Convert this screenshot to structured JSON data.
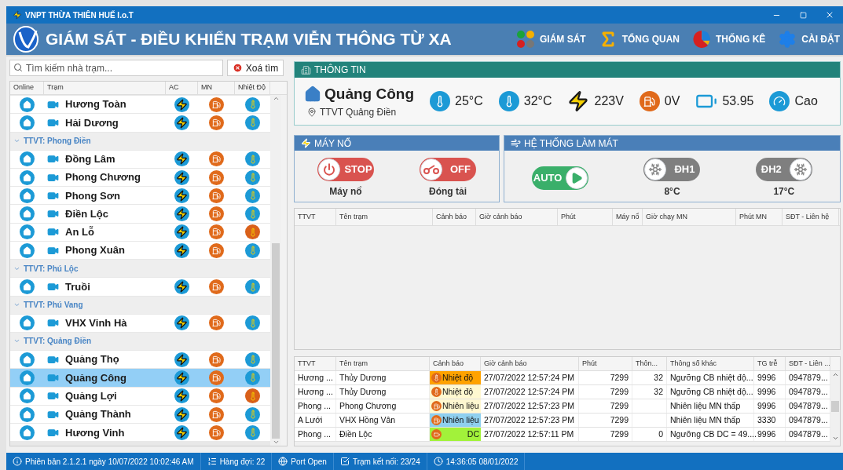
{
  "window": {
    "title": "VNPT THỪA THIÊN HUẾ I.o.T"
  },
  "header": {
    "title": "GIÁM SÁT - ĐIỀU KHIỂN TRẠM VIỄN THÔNG TỪ XA",
    "nav": [
      {
        "label": "GIÁM SÁT",
        "kind": "monitor"
      },
      {
        "label": "TỔNG QUAN",
        "kind": "overview"
      },
      {
        "label": "THỐNG KÊ",
        "kind": "stats"
      },
      {
        "label": "CÀI ĐẶT",
        "kind": "settings"
      }
    ]
  },
  "search": {
    "placeholder": "Tìm kiếm nhà trạm...",
    "clear_button": "Xoá tìm"
  },
  "station_table": {
    "columns": [
      "Online",
      "Trạm",
      "AC",
      "MN",
      "Nhiệt Độ"
    ],
    "groups": [
      {
        "stations": [
          {
            "name": "Hương Toàn",
            "selected": false,
            "temp_alert": false
          },
          {
            "name": "Hải Dương",
            "selected": false,
            "temp_alert": false
          }
        ]
      },
      {
        "label": "TTVT: Phong Điền",
        "expanded": true,
        "stations": [
          {
            "name": "Đồng Lâm",
            "selected": false,
            "temp_alert": false
          },
          {
            "name": "Phong Chương",
            "selected": false,
            "temp_alert": false
          },
          {
            "name": "Phong Sơn",
            "selected": false,
            "temp_alert": false
          },
          {
            "name": "Điền Lộc",
            "selected": false,
            "temp_alert": false
          },
          {
            "name": "An Lỗ",
            "selected": false,
            "temp_alert": true
          },
          {
            "name": "Phong Xuân",
            "selected": false,
            "temp_alert": false
          }
        ]
      },
      {
        "label": "TTVT: Phú Lộc",
        "expanded": true,
        "stations": [
          {
            "name": "Truồi",
            "selected": false,
            "temp_alert": false
          }
        ]
      },
      {
        "label": "TTVT: Phú Vang",
        "expanded": true,
        "stations": [
          {
            "name": "VHX Vinh Hà",
            "selected": false,
            "temp_alert": false
          }
        ]
      },
      {
        "label": "TTVT: Quảng Điền",
        "expanded": true,
        "stations": [
          {
            "name": "Quảng Thọ",
            "selected": false,
            "temp_alert": false
          },
          {
            "name": "Quảng Công",
            "selected": true,
            "temp_alert": false
          },
          {
            "name": "Quảng Lợi",
            "selected": false,
            "temp_alert": true
          },
          {
            "name": "Quảng Thành",
            "selected": false,
            "temp_alert": false
          },
          {
            "name": "Hương Vinh",
            "selected": false,
            "temp_alert": false
          }
        ]
      }
    ]
  },
  "info": {
    "title": "THÔNG TIN",
    "station": "Quảng Công",
    "location": "TTVT Quảng Điền",
    "readings": [
      {
        "kind": "temp",
        "value": "25°C"
      },
      {
        "kind": "temp",
        "value": "32°C"
      },
      {
        "kind": "ac",
        "value": "223V"
      },
      {
        "kind": "generator",
        "value": "0V"
      },
      {
        "kind": "battery",
        "value": "53.95"
      },
      {
        "kind": "gauge",
        "value": "Cao"
      }
    ]
  },
  "generator": {
    "title": "MÁY NỔ",
    "toggles": [
      {
        "kind": "power",
        "text": "STOP",
        "label": "Máy nổ",
        "color": "#d9534f",
        "knob_right": false
      },
      {
        "kind": "load",
        "text": "OFF",
        "label": "Đóng tải",
        "color": "#d9534f",
        "knob_right": false
      }
    ]
  },
  "cooling": {
    "title": "HỆ THỐNG LÀM MÁT",
    "toggles": [
      {
        "kind": "auto",
        "text": "AUTO",
        "color": "#3aaf6a",
        "knob_right": true
      },
      {
        "kind": "fan",
        "text": "ĐH1",
        "label": "8°C",
        "color": "#7f7f7f",
        "knob_right": false
      },
      {
        "kind": "fan",
        "text": "ĐH2",
        "label": "17°C",
        "color": "#7f7f7f",
        "knob_right": true
      }
    ]
  },
  "log_table": {
    "columns": [
      "TTVT",
      "Tên trạm",
      "Cảnh báo",
      "Giờ cảnh báo",
      "Phút",
      "Máy nổ",
      "Giờ chạy MN",
      "Phút MN",
      "SĐT - Liên hệ"
    ]
  },
  "alert_table": {
    "columns": [
      "TTVT",
      "Tên trạm",
      "Cảnh báo",
      "Giờ cảnh báo",
      "Phút",
      "Thôn...",
      "Thông số khác",
      "TG trễ",
      "SĐT - Liên ..."
    ],
    "rows": [
      {
        "ttvt": "Hương ...",
        "station": "Thủy Dương",
        "alert": {
          "kind": "temp",
          "text": "Nhiệt độ",
          "color": "#ffa200"
        },
        "time": "27/07/2022 12:57:24 PM",
        "minutes": "7299",
        "column_6": "32",
        "other": "Ngưỡng CB nhiệt độ...",
        "delay": "9996",
        "phone": "0947879..."
      },
      {
        "ttvt": "Hương ...",
        "station": "Thủy Dương",
        "alert": {
          "kind": "temp",
          "text": "Nhiệt độ",
          "color": "#fff8d0"
        },
        "time": "27/07/2022 12:57:24 PM",
        "minutes": "7299",
        "column_6": "32",
        "other": "Ngưỡng CB nhiệt độ...",
        "delay": "9996",
        "phone": "0947879..."
      },
      {
        "ttvt": "Phong ...",
        "station": "Phong Chương",
        "alert": {
          "kind": "fuel",
          "text": "Nhiên liệu",
          "color": "#fff8d0"
        },
        "time": "27/07/2022 12:57:23 PM",
        "minutes": "7299",
        "other": "Nhiên liệu MN thấp",
        "delay": "9996",
        "phone": "0947879..."
      },
      {
        "ttvt": "A Lưới",
        "station": "VHX Hồng Vân",
        "alert": {
          "kind": "fuel",
          "text": "Nhiên liệu",
          "color": "#8fd0ef"
        },
        "time": "27/07/2022 12:57:23 PM",
        "minutes": "7299",
        "other": "Nhiên liệu MN thấp",
        "delay": "3330",
        "phone": "0947879..."
      },
      {
        "ttvt": "Phong ...",
        "station": "Điền Lộc",
        "alert": {
          "kind": "dc",
          "text": "DC",
          "color": "#a2f23a"
        },
        "time": "27/07/2022 12:57:11 PM",
        "minutes": "7299",
        "column_6": "0",
        "other": "Ngưỡng CB DC = 49....",
        "delay": "9996",
        "phone": "0947879..."
      }
    ]
  },
  "status_bar": [
    {
      "kind": "info",
      "text": "Phiên bản 2.1.2.1 ngày 10/07/2022 10:02:46 AM"
    },
    {
      "kind": "queue",
      "text": "Hàng đợi: 22"
    },
    {
      "kind": "globe",
      "text": "Port Open"
    },
    {
      "kind": "check",
      "text": "Trạm kết nối: 23/24"
    },
    {
      "kind": "clock",
      "text": "14:36:05 08/01/2022"
    }
  ]
}
